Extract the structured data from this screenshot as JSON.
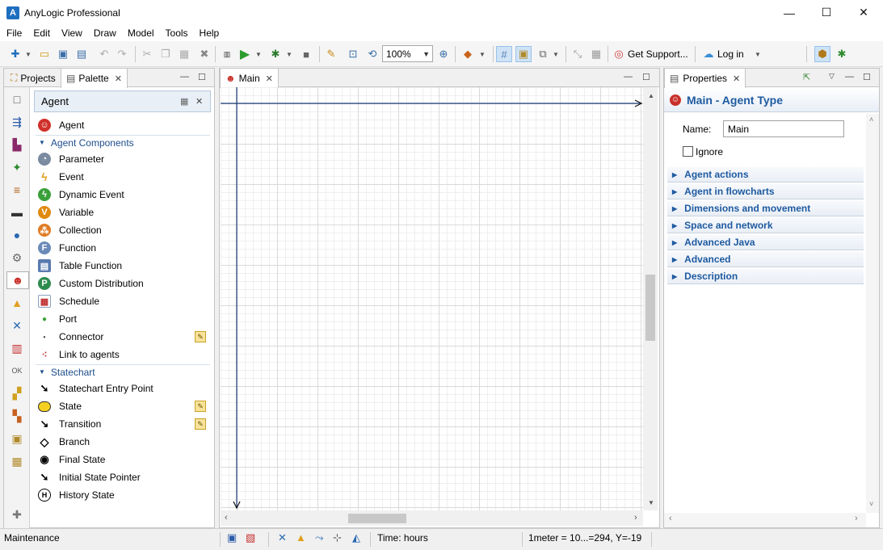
{
  "window": {
    "title": "AnyLogic Professional",
    "minimize": "—",
    "maximize": "☐",
    "close": "✕"
  },
  "menu": [
    "File",
    "Edit",
    "View",
    "Draw",
    "Model",
    "Tools",
    "Help"
  ],
  "toolbar": {
    "zoom_value": "100%",
    "get_support_label": "Get Support...",
    "login_label": "Log in"
  },
  "left_panel": {
    "tabs": [
      {
        "label": "Projects"
      },
      {
        "label": "Palette"
      }
    ],
    "palette_title": "Agent",
    "top_item": "Agent",
    "sections": [
      {
        "title": "Agent Components",
        "items": [
          "Parameter",
          "Event",
          "Dynamic Event",
          "Variable",
          "Collection",
          "Function",
          "Table Function",
          "Custom Distribution",
          "Schedule",
          "Port",
          "Connector",
          "Link to agents"
        ]
      },
      {
        "title": "Statechart",
        "items": [
          "Statechart Entry Point",
          "State",
          "Transition",
          "Branch",
          "Final State",
          "Initial State Pointer",
          "History State"
        ]
      }
    ]
  },
  "editor": {
    "tab_label": "Main"
  },
  "properties": {
    "tab_label": "Properties",
    "heading": "Main - Agent Type",
    "name_label": "Name:",
    "name_value": "Main",
    "ignore_label": "Ignore",
    "ignore_checked": false,
    "sections": [
      "Agent actions",
      "Agent in flowcharts",
      "Dimensions and movement",
      "Space and network",
      "Advanced Java",
      "Advanced",
      "Description"
    ]
  },
  "status": {
    "left": "Maintenance",
    "time": "Time: hours",
    "scale": "1meter = 10...=294, Y=-19"
  },
  "colors": {
    "accent": "#1e5aa0",
    "axis": "#1a3c78",
    "highlight": "#cfe3f7"
  }
}
